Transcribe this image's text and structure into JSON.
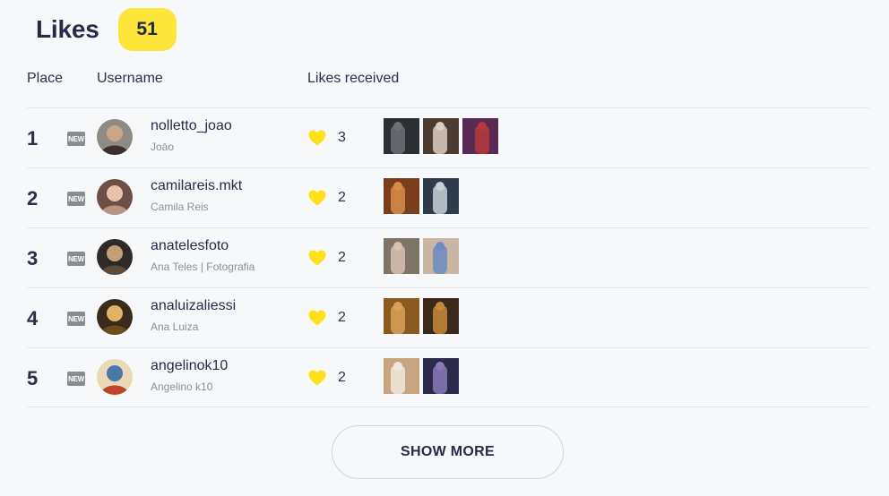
{
  "header": {
    "title": "Likes",
    "count": "51"
  },
  "columns": {
    "place": "Place",
    "username": "Username",
    "likes_received": "Likes received"
  },
  "new_label": "NEW",
  "rows": [
    {
      "place": "1",
      "username": "nolletto_joao",
      "full_name": "Joāo",
      "likes": "3",
      "avatar_colors": [
        "#3b2f2a",
        "#c9a58d",
        "#8e8a86"
      ],
      "thumbs": [
        [
          "#2c2f33",
          "#6c7178"
        ],
        [
          "#4a3b33",
          "#d9cfc4"
        ],
        [
          "#5a2b52",
          "#b83a3a"
        ]
      ]
    },
    {
      "place": "2",
      "username": "camilareis.mkt",
      "full_name": "Camila Reis",
      "likes": "2",
      "avatar_colors": [
        "#b79486",
        "#e7c3a7",
        "#6d4f45"
      ],
      "thumbs": [
        [
          "#7a3e1c",
          "#d98d4a"
        ],
        [
          "#2d3b4a",
          "#c9d0d8"
        ]
      ]
    },
    {
      "place": "3",
      "username": "anatelesfoto",
      "full_name": "Ana Teles | Fotografia",
      "likes": "2",
      "avatar_colors": [
        "#5a4a3a",
        "#c29e7a",
        "#2e2a27"
      ],
      "thumbs": [
        [
          "#7f7468",
          "#d6c2b1"
        ],
        [
          "#c9b5a4",
          "#6b8cc2"
        ]
      ]
    },
    {
      "place": "4",
      "username": "analuizaliessi",
      "full_name": "Ana Luiza",
      "likes": "2",
      "avatar_colors": [
        "#6a4c1f",
        "#e1b26a",
        "#3a2c1a"
      ],
      "thumbs": [
        [
          "#8a5a22",
          "#d8a25a"
        ],
        [
          "#3b2a1c",
          "#c88a3a"
        ]
      ]
    },
    {
      "place": "5",
      "username": "angelinok10",
      "full_name": "Angelino k10",
      "likes": "2",
      "avatar_colors": [
        "#c2432c",
        "#4a78a8",
        "#e9d9b6"
      ],
      "thumbs": [
        [
          "#c7a583",
          "#f0e7da"
        ],
        [
          "#2c2a4a",
          "#8a7ab8"
        ]
      ]
    }
  ],
  "show_more": "SHOW MORE",
  "colors": {
    "accent_yellow": "#fde53a",
    "heart": "#ffe01b",
    "text": "#262b4a",
    "muted": "#8b8f99"
  }
}
